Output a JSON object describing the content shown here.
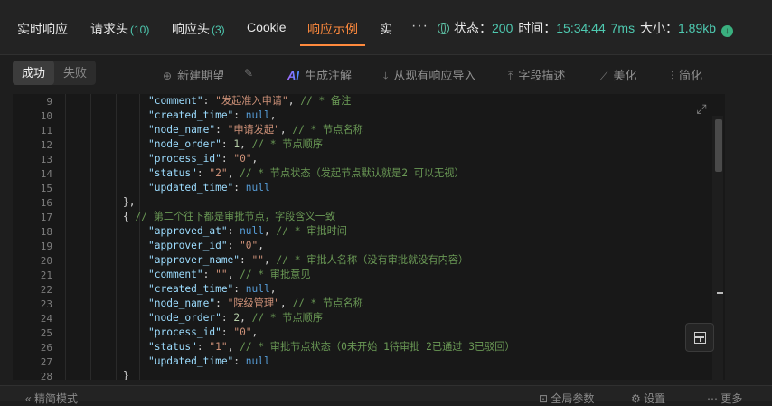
{
  "tabs": [
    {
      "label": "实时响应",
      "count": ""
    },
    {
      "label": "请求头",
      "count": "(10)"
    },
    {
      "label": "响应头",
      "count": "(3)"
    },
    {
      "label": "Cookie",
      "count": ""
    },
    {
      "label": "响应示例",
      "count": ""
    },
    {
      "label": "实",
      "count": ""
    }
  ],
  "more_label": "···",
  "status": {
    "status_label": "状态：",
    "status_value": "200",
    "time_label": "时间：",
    "time_value": "15:34:44",
    "duration_value": "7ms",
    "size_label": "大小：",
    "size_value": "1.89kb"
  },
  "toolbar": {
    "success_label": "成功",
    "fail_label": "失败",
    "new_expect_label": "新建期望",
    "ai_label": "AI",
    "generate_comment_label": "生成注解",
    "import_label": "从现有响应导入",
    "field_desc_label": "字段描述",
    "beautify_label": "美化",
    "simplify_label": "简化"
  },
  "code": {
    "line_numbers": [
      "9",
      "10",
      "11",
      "12",
      "13",
      "14",
      "15",
      "16",
      "17",
      "18",
      "19",
      "20",
      "21",
      "22",
      "23",
      "24",
      "25",
      "26",
      "27",
      "28"
    ],
    "lines": [
      "\"comment\": \"发起准入申请\", // * 备注",
      "\"created_time\": null,",
      "\"node_name\": \"申请发起\", // * 节点名称",
      "\"node_order\": 1, // * 节点顺序",
      "\"process_id\": \"0\",",
      "\"status\": \"2\", // * 节点状态（发起节点默认就是2 可以无视）",
      "\"updated_time\": null",
      "},",
      "{ // 第二个往下都是审批节点，字段含义一致",
      "\"approved_at\": null, // * 审批时间",
      "\"approver_id\": \"0\",",
      "\"approver_name\": \"\", // * 审批人名称（没有审批就没有内容）",
      "\"comment\": \"\", // * 审批意见",
      "\"created_time\": null,",
      "\"node_name\": \"院级管理\", // * 节点名称",
      "\"node_order\": 2, // * 节点顺序",
      "\"process_id\": \"0\",",
      "\"status\": \"1\", // * 审批节点状态（0未开始 1待审批 2已通过 3已驳回）",
      "\"updated_time\": null",
      "}"
    ]
  },
  "bottom": {
    "simple_mode_label": "« 精简模式",
    "global_params_label": "全局参数",
    "settings_label": "设置",
    "more_label": "更多"
  }
}
